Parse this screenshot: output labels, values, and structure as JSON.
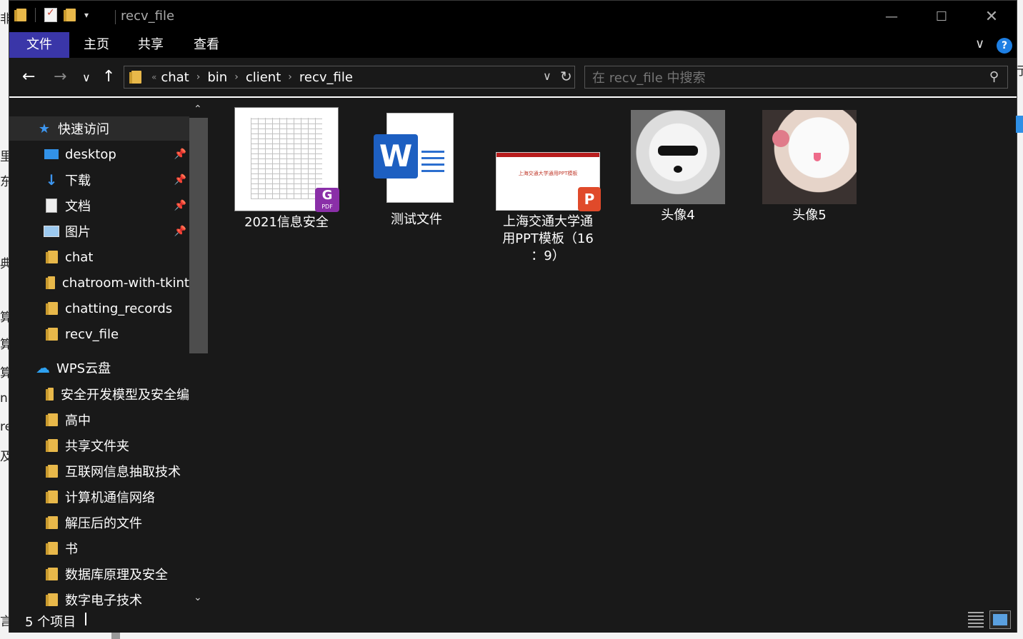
{
  "window": {
    "title": "recv_file",
    "minimize_icon": "—",
    "maximize_icon": "☐",
    "close_icon": "✕"
  },
  "ribbon": {
    "tabs": [
      "文件",
      "主页",
      "共享",
      "查看"
    ],
    "expand_icon": "∨",
    "help_icon": "?"
  },
  "nav": {
    "back": "←",
    "forward": "→",
    "recent": "∨",
    "up": "↑",
    "breadcrumb_prefix": "«",
    "breadcrumb": [
      "chat",
      "bin",
      "client",
      "recv_file"
    ],
    "breadcrumb_sep": "›",
    "dropdown": "∨",
    "refresh": "↻"
  },
  "search": {
    "placeholder": "在 recv_file 中搜索",
    "icon": "search-icon"
  },
  "sidebar": {
    "quick_access": "快速访问",
    "pinned": [
      {
        "label": "desktop",
        "icon": "desktop-icon"
      },
      {
        "label": "下载",
        "icon": "download-icon"
      },
      {
        "label": "文档",
        "icon": "document-icon"
      },
      {
        "label": "图片",
        "icon": "pictures-icon"
      }
    ],
    "folders": [
      "chat",
      "chatroom-with-tkint",
      "chatting_records",
      "recv_file"
    ],
    "wps": "WPS云盘",
    "wps_folders": [
      "安全开发模型及安全编",
      "高中",
      "共享文件夹",
      "互联网信息抽取技术",
      "计算机通信网络",
      "解压后的文件",
      "书",
      "数据库原理及安全",
      "数字电子技术"
    ]
  },
  "files": [
    {
      "name": "2021信息安全",
      "type": "pdf"
    },
    {
      "name": "测试文件",
      "type": "word"
    },
    {
      "name_lines": [
        "上海交通大学通",
        "用PPT模板（16",
        "：9）"
      ],
      "type": "ppt",
      "thumb_title": "上海交通大学通用PPT模板"
    },
    {
      "name": "头像4",
      "type": "image"
    },
    {
      "name": "头像5",
      "type": "image"
    }
  ],
  "status": {
    "count": "5 个项目"
  },
  "colors": {
    "file_tab": "#3a36a8",
    "accent_blue": "#1e7fe3",
    "folder": "#e8b84a",
    "background": "#191919"
  }
}
